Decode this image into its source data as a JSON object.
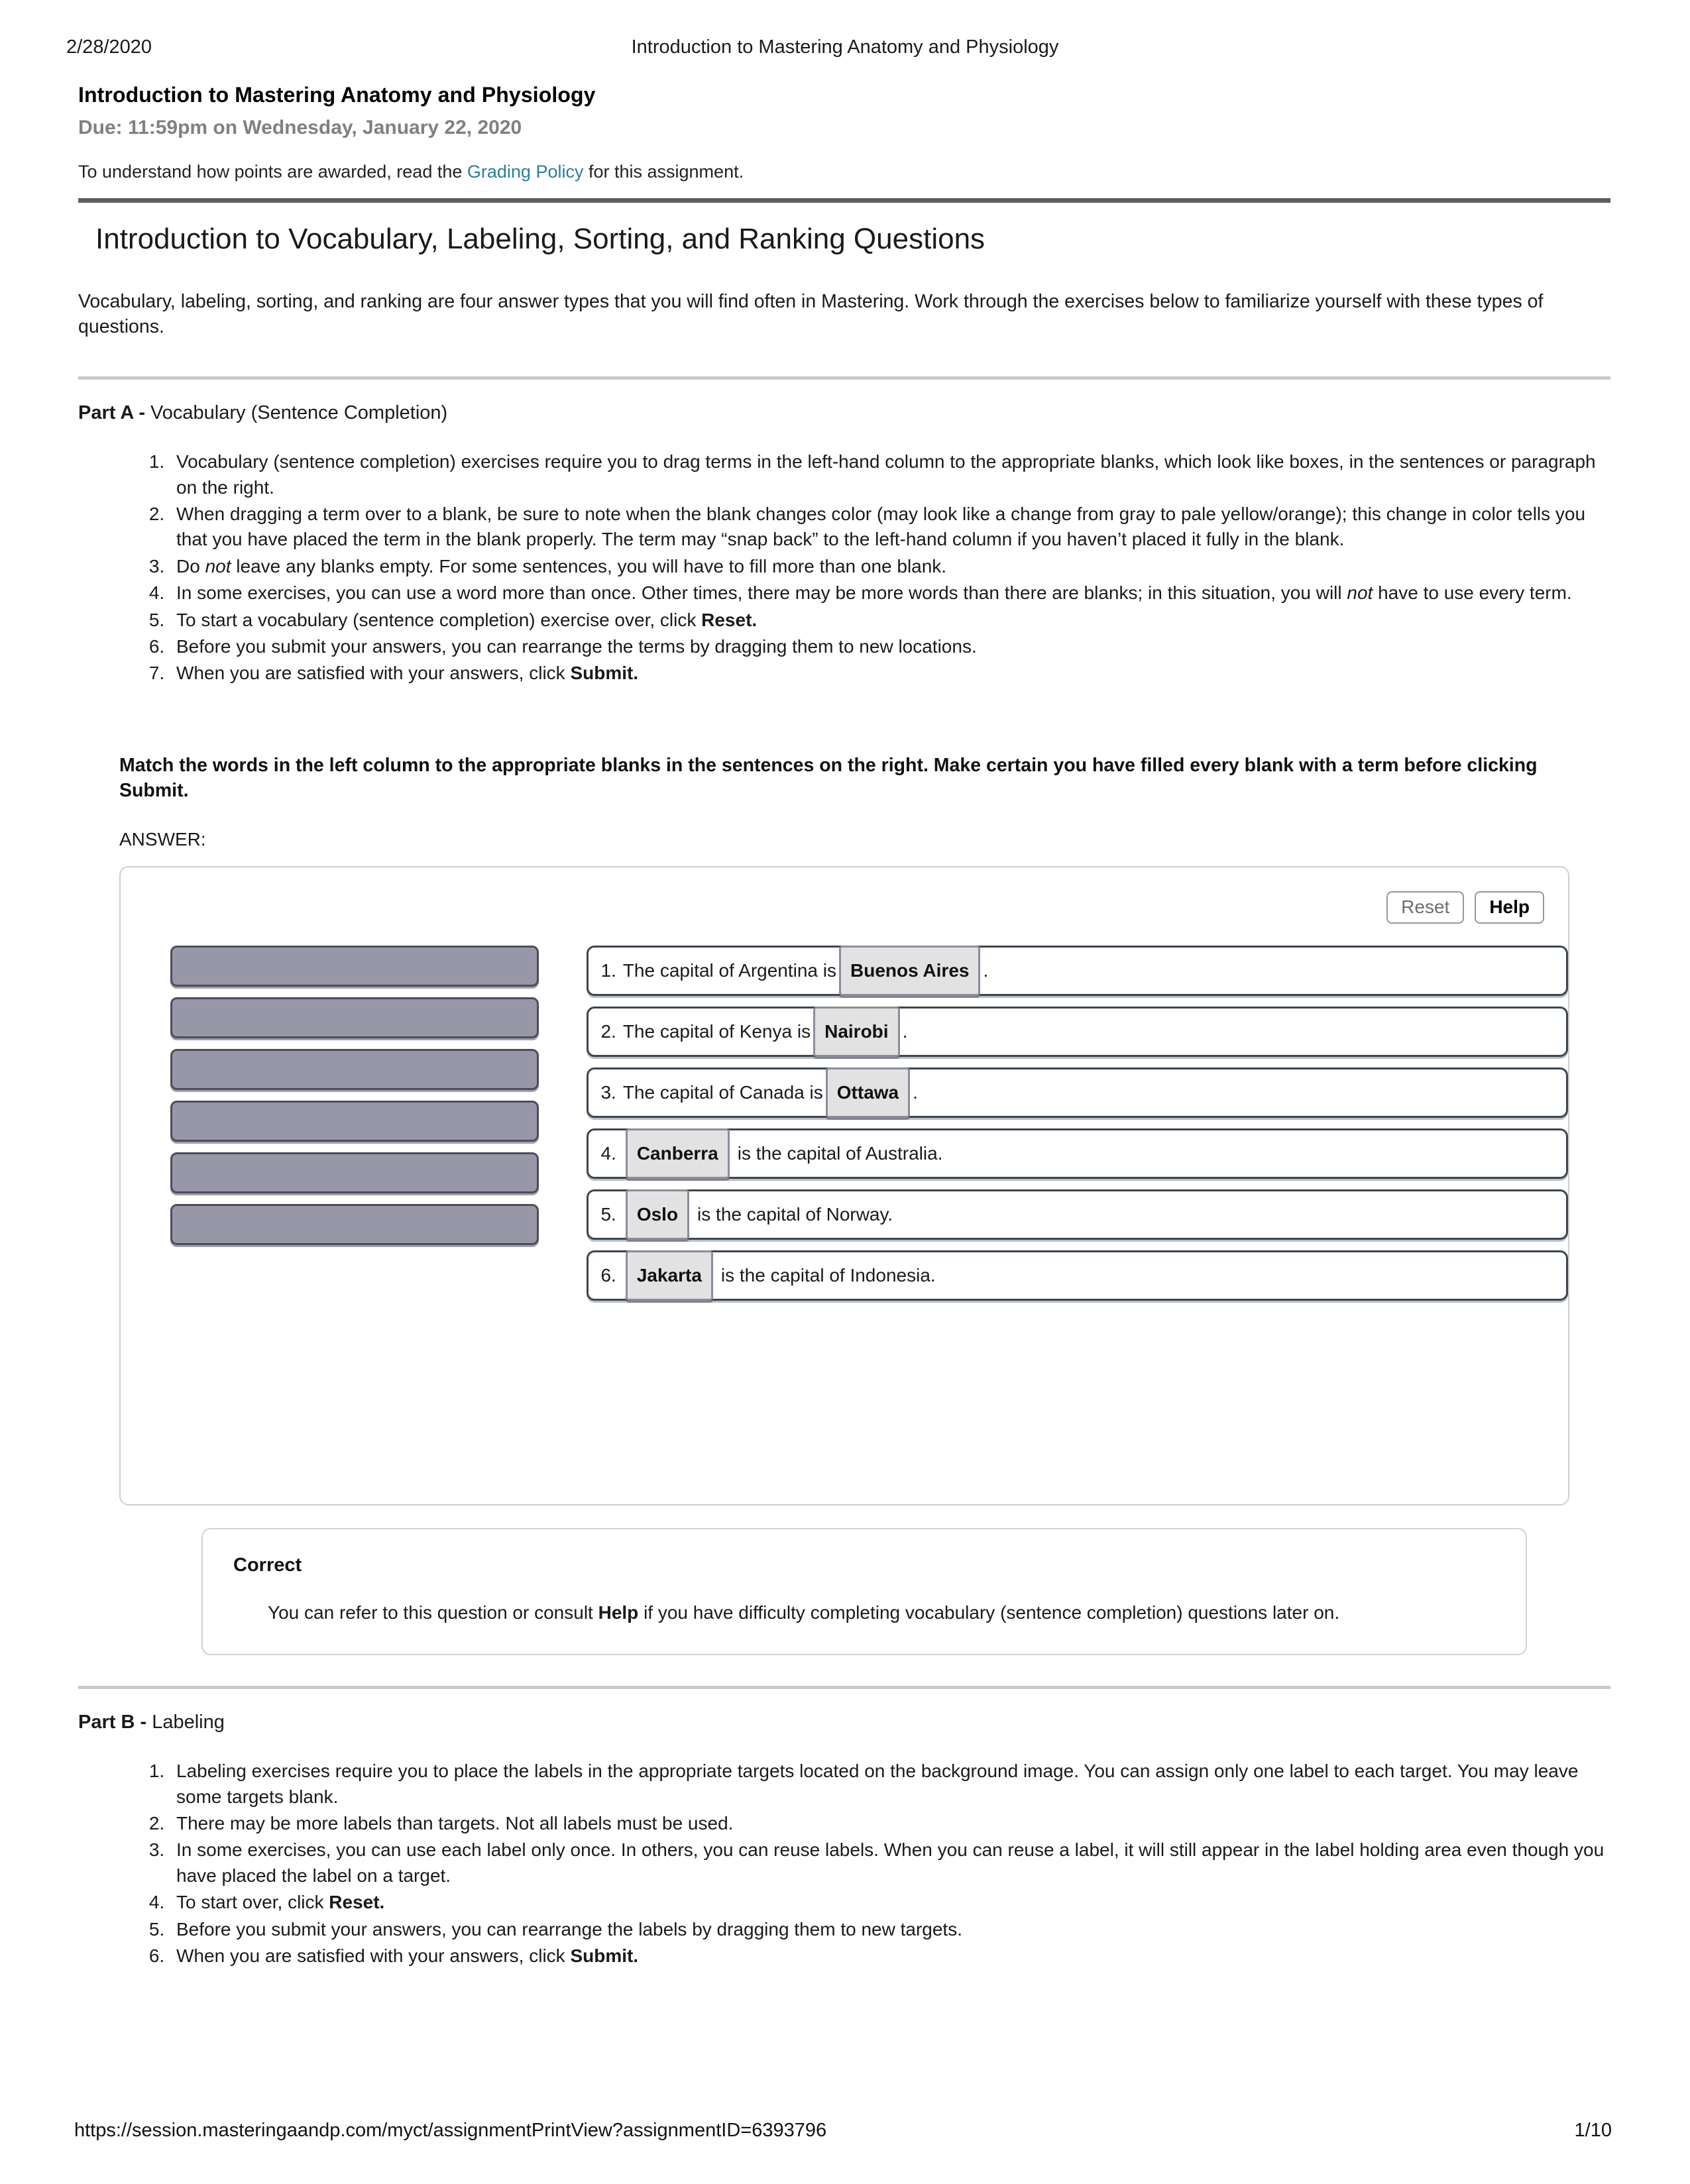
{
  "print_header": {
    "date": "2/28/2020",
    "title": "Introduction to Mastering Anatomy and Physiology"
  },
  "assignment": {
    "title": "Introduction to Mastering Anatomy and Physiology",
    "due": "Due: 11:59pm on Wednesday, January 22, 2020",
    "grading_prefix": "To understand how points are awarded, read the ",
    "grading_link": "Grading Policy",
    "grading_suffix": " for this assignment."
  },
  "section": {
    "title": "Introduction to Vocabulary, Labeling, Sorting, and Ranking Questions",
    "intro": "Vocabulary, labeling, sorting, and ranking are four answer types that you will find often in Mastering. Work through the exercises below to familiarize yourself with these types of questions."
  },
  "part_a": {
    "label": "Part A - ",
    "name": "Vocabulary (Sentence Completion)",
    "rules": [
      "Vocabulary (sentence completion) exercises require you to drag terms in the left-hand column to the appropriate blanks, which look like boxes, in the sentences or paragraph on the right.",
      "When dragging a term over to a blank, be sure to note when the blank changes color (may look like a change from gray to pale yellow/orange); this change in color tells you that you have placed the term in the blank properly. The term may “snap back” to the left-hand column if you haven’t placed it fully in the blank.",
      "Do not leave any blanks empty. For some sentences, you will have to fill more than one blank.",
      "In some exercises, you can use a word more than once. Other times, there may be more words than there are blanks; in this situation, you will not have to use every term.",
      "To start a vocabulary (sentence completion) exercise over, click Reset.",
      "Before you submit your answers, you can rearrange the terms by dragging them to new locations.",
      "When you are satisfied with your answers, click Submit."
    ],
    "instruction": "Match the words in the left column to the appropriate blanks in the sentences on the right. Make certain you have filled every blank with a term before clicking Submit.",
    "answer_label": "ANSWER:",
    "toolbar": {
      "reset_label": "Reset",
      "help_label": "Help"
    },
    "term_slots": [
      "",
      "",
      "",
      "",
      "",
      ""
    ],
    "sentences": [
      {
        "num": "1.",
        "before": "The capital of Argentina is",
        "term": "Buenos Aires",
        "after": "."
      },
      {
        "num": "2.",
        "before": "The capital of Kenya is",
        "term": "Nairobi",
        "after": "."
      },
      {
        "num": "3.",
        "before": "The capital of Canada is",
        "term": "Ottawa",
        "after": "."
      },
      {
        "num": "4.",
        "before": "",
        "term": "Canberra",
        "after": "is the capital of Australia."
      },
      {
        "num": "5.",
        "before": "",
        "term": "Oslo",
        "after": "is the capital of Norway."
      },
      {
        "num": "6.",
        "before": "",
        "term": "Jakarta",
        "after": "is the capital of Indonesia."
      }
    ],
    "feedback": {
      "title": "Correct",
      "body_before": "You can refer to this question or consult ",
      "body_bold": "Help",
      "body_after": " if you have difficulty completing vocabulary (sentence completion) questions later on."
    }
  },
  "part_b": {
    "label": "Part B - ",
    "name": "Labeling",
    "rules": [
      "Labeling exercises require you to place the labels in the appropriate targets located on the background image. You can assign only one label to each target. You may leave some targets blank.",
      "There may be more labels than targets. Not all labels must be used.",
      "In some exercises, you can use each label only once. In others, you can reuse labels. When you can reuse a label, it will still appear in the label holding area even though you have placed the label on a target.",
      "To start over, click Reset.",
      "Before you submit your answers, you can rearrange the labels by dragging them to new targets.",
      "When you are satisfied with your answers, click Submit."
    ]
  },
  "print_footer": {
    "url": "https://session.masteringaandp.com/myct/assignmentPrintView?assignmentID=6393796",
    "page": "1/10"
  },
  "colors": {
    "link": "#2a7d9b",
    "term_slot": "#9797a8",
    "term_chip": "#e2e2e2",
    "row_border": "#3c4650",
    "rule_thick": "#5f5f5f",
    "rule_thin": "#c9c9c9",
    "due_text": "#808080"
  }
}
